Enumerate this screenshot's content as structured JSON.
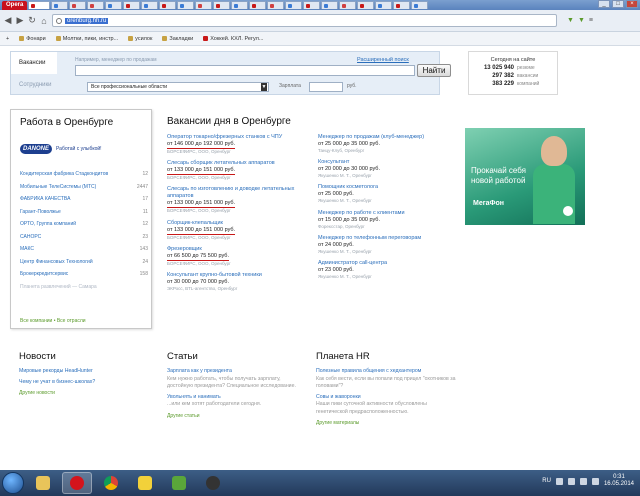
{
  "browser": {
    "opera_label": "Opera",
    "url": "orenburg.hh.ru",
    "bookmarks": [
      {
        "label": "Фонари",
        "color": "#c7a243"
      },
      {
        "label": "Молтки, пики, инстр...",
        "color": "#c7a243"
      },
      {
        "label": "усилок",
        "color": "#c7a243"
      },
      {
        "label": "Закладки",
        "color": "#c7a243"
      },
      {
        "label": "Хоккей. КХЛ. Регул...",
        "color": "#c81818"
      }
    ]
  },
  "search": {
    "tab_vacancies": "Вакансии",
    "tab_employees": "Сотрудники",
    "hint": "Например, менеджер по продажам",
    "extended_link": "Расширенный поиск",
    "find_button": "Найти",
    "area_select": "Все профессиональные области",
    "salary_label": "Зарплата",
    "rub": "руб."
  },
  "stats": {
    "title": "Сегодня на сайте",
    "rows": [
      {
        "num": "13 025 940",
        "label": "резюме"
      },
      {
        "num": "297 382",
        "label": "вакансии"
      },
      {
        "num": "383 229",
        "label": "компаний"
      }
    ]
  },
  "work": {
    "title": "Работа в Оренбурге",
    "danone_logo": "DANONE",
    "danone_text": "Работай с улыбкой!",
    "companies": [
      {
        "name": "Кондитерская фабрика Стадкондитов",
        "count": "12"
      },
      {
        "name": "Мобильные ТелеСистемы (МТС)",
        "count": "2447"
      },
      {
        "name": "ФАБРИКА КАЧЕСТВА",
        "count": "17"
      },
      {
        "name": "Гарант-Поволжье",
        "count": "11"
      },
      {
        "name": "ОРТО, Группа компаний",
        "count": "12"
      },
      {
        "name": "САНОРС",
        "count": "23"
      },
      {
        "name": "МАКС",
        "count": "143"
      },
      {
        "name": "Центр Финансовых Технологий",
        "count": "24"
      },
      {
        "name": "Брокеркредитсервис",
        "count": "158"
      },
      {
        "name": "Планета развлечений — Самара",
        "count": ""
      }
    ],
    "footer": "Все компании • Все отрасли"
  },
  "vacancies": {
    "title": "Вакансии дня в Оренбурге",
    "col1": [
      {
        "title": "Оператор токарно/фрезерных станков с ЧПУ",
        "salary": "от 146 000 до 192 000 руб.",
        "company": "БОРСЕФИРС, ООО, Оренбург",
        "marked": true
      },
      {
        "title": "Слесарь сборщик летательных аппаратов",
        "salary": "от 133 000 до 151 000 руб.",
        "company": "БОРСЕФИРС, ООО, Оренбург",
        "marked": true
      },
      {
        "title": "Слесарь по изготовлению и доводке летательных аппаратов",
        "salary": "от 133 000 до 151 000 руб.",
        "company": "БОРСЕФИРС, ООО, Оренбург",
        "marked": true
      },
      {
        "title": "Сборщик-клепальщик",
        "salary": "от 133 000 до 151 000 руб.",
        "company": "БОРСЕФИРС, ООО, Оренбург",
        "marked": true
      },
      {
        "title": "Фрезеровщик",
        "salary": "от 66 500 до 75 500 руб.",
        "company": "БОРСЕФИРС, ООО, Оренбург",
        "marked": true
      },
      {
        "title": "Консультант крупно-бытовой техники",
        "salary": "от 30 000 до 70 000 руб.",
        "company": "ЭКРосс, BTL-агентство, Оренбург",
        "marked": false
      }
    ],
    "col2": [
      {
        "title": "Менеджер по продажам (клуб-менеджер)",
        "salary": "от 25 000 до 35 000 руб.",
        "company": "Танцу-Клуб, Оренбург"
      },
      {
        "title": "Консультант",
        "salary": "от 20 000 до 30 000 руб.",
        "company": "Якушенко М. Т., Оренбург"
      },
      {
        "title": "Помощник косметолога",
        "salary": "от 25 000 руб.",
        "company": "Якушенко М. Т., Оренбург"
      },
      {
        "title": "Менеджер по работе с клиентами",
        "salary": "от 15 000 до 35 000 руб.",
        "company": "Форексстар, Оренбург"
      },
      {
        "title": "Менеджер по телефонным переговорам",
        "salary": "от 24 000 руб.",
        "company": "Якушенко М. Т., Оренбург"
      },
      {
        "title": "Администратор call-центра",
        "salary": "от 23 000 руб.",
        "company": "Якушенко М. Т., Оренбург"
      }
    ]
  },
  "ad": {
    "text": "Прокачай себя новой работой",
    "brand": "МегаФон"
  },
  "news": {
    "title": "Новости",
    "items": [
      {
        "link": "Мировые рекорды HeadHunter",
        "desc": ""
      },
      {
        "link": "Чему не учат в бизнес-школах?",
        "desc": ""
      }
    ],
    "footer": "Другие новости"
  },
  "articles": {
    "title": "Статьи",
    "items": [
      {
        "link": "Зарплата как у президента",
        "desc": "Кем нужно работать, чтобы получать зарплату, достойную президента? Специальное исследование."
      },
      {
        "link": "Увольнять и нанимать",
        "desc": "...или кем хотят работодатели сегодня."
      }
    ],
    "footer": "Другие статьи"
  },
  "planet": {
    "title": "Планета HR",
    "items": [
      {
        "link": "Полезные правила общения с хедхантером",
        "desc": "Как себя вести, если вы попали под прицел \"охотников за головами\"?"
      },
      {
        "link": "Совы и жаворонки",
        "desc": "Наши пики суточной активности обусловлены генетической предрасположенностью."
      }
    ],
    "footer": "Другие материалы"
  },
  "taskbar": {
    "lang": "RU",
    "time": "0:31",
    "date": "16.05.2014"
  }
}
